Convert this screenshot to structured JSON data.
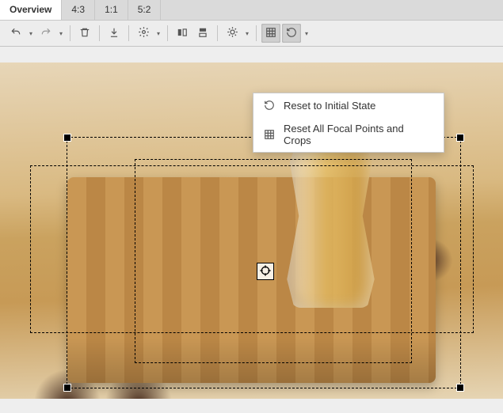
{
  "tabs": [
    {
      "label": "Overview",
      "active": true
    },
    {
      "label": "4:3",
      "active": false
    },
    {
      "label": "1:1",
      "active": false
    },
    {
      "label": "5:2",
      "active": false
    }
  ],
  "toolbar": {
    "undo": {
      "icon": "undo-icon"
    },
    "redo": {
      "icon": "redo-icon"
    },
    "trash": {
      "icon": "trash-icon"
    },
    "download": {
      "icon": "download-icon"
    },
    "gear": {
      "icon": "gear-icon"
    },
    "flip_h": {
      "icon": "flip-horizontal-icon"
    },
    "flip_v": {
      "icon": "flip-vertical-icon"
    },
    "brightness": {
      "icon": "brightness-icon"
    },
    "grid": {
      "icon": "grid-icon"
    },
    "reset": {
      "icon": "reset-icon"
    }
  },
  "reset_menu": {
    "items": [
      {
        "label": "Reset to Initial State",
        "icon": "reset-icon"
      },
      {
        "label": "Reset All Focal Points and Crops",
        "icon": "grid-icon"
      }
    ]
  }
}
